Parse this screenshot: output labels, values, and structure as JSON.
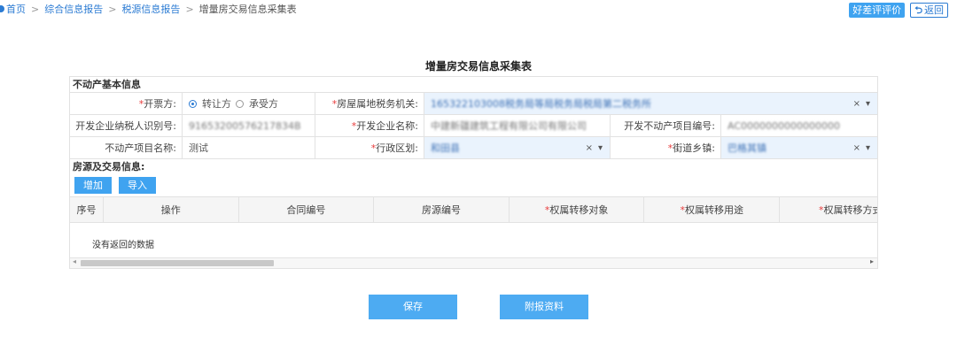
{
  "breadcrumb": {
    "home": "首页",
    "sep": ">",
    "item1": "综合信息报告",
    "item2": "税源信息报告",
    "current": "增量房交易信息采集表"
  },
  "top_buttons": {
    "rate": "好差评评价",
    "back": "返回"
  },
  "page_title": "增量房交易信息采集表",
  "section1": {
    "title": "不动产基本信息",
    "rows": [
      {
        "l1": "开票方:",
        "opt1": "转让方",
        "opt2": "承受方",
        "l2": "房屋属地税务机关:",
        "v2": "165322103008税务局等局税务局税局第二税务所"
      },
      {
        "l1": "开发企业纳税人识别号:",
        "v1": "91653200576217834B",
        "l2": "开发企业名称:",
        "v2": "中建新疆建筑工程有限公司有限公司",
        "l3": "开发不动产项目编号:",
        "v3": "AC0000000000000000"
      },
      {
        "l1": "不动产项目名称:",
        "v1": "测试",
        "l2": "行政区划:",
        "v2": "和田县",
        "l3": "街道乡镇:",
        "v3": "巴格其镇"
      }
    ],
    "select_clear": "×",
    "select_arrow": "▾"
  },
  "section2": {
    "title": "房源及交易信息:",
    "add_btn": "增加",
    "import_btn": "导入",
    "columns": [
      "序号",
      "操作",
      "合同编号",
      "房源编号",
      "*权属转移对象",
      "*权属转移用途",
      "*权属转移方式"
    ],
    "empty_text": "没有返回的数据"
  },
  "bottom": {
    "save": "保存",
    "attach": "附报资料"
  }
}
